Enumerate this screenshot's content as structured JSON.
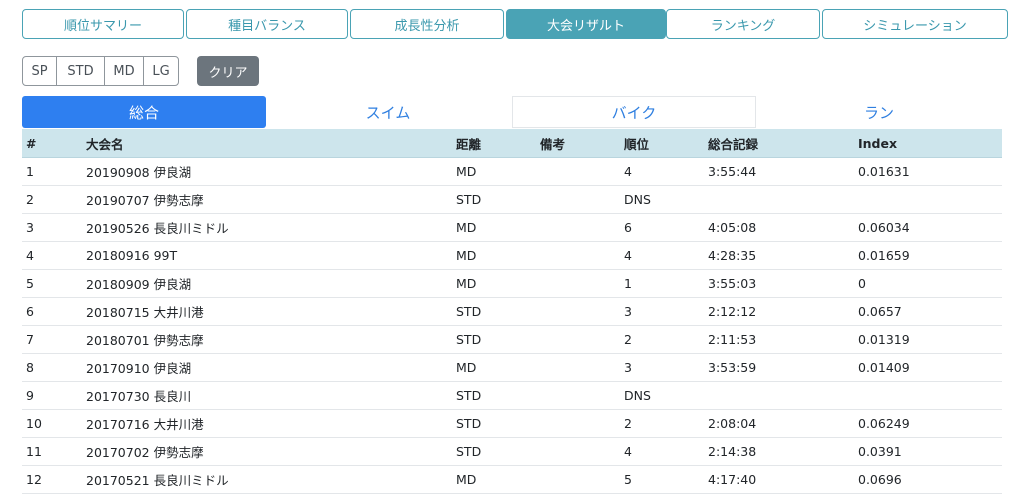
{
  "topnav": {
    "tabs": [
      {
        "label": "順位サマリー"
      },
      {
        "label": "種目バランス"
      },
      {
        "label": "成長性分析"
      },
      {
        "label": "大会リザルト"
      },
      {
        "label": "ランキング"
      },
      {
        "label": "シミュレーション"
      }
    ],
    "active_index": 3
  },
  "size_filter": {
    "options": [
      "SP",
      "STD",
      "MD",
      "LG"
    ],
    "clear_label": "クリア"
  },
  "subtabs": {
    "items": [
      {
        "label": "総合"
      },
      {
        "label": "スイム"
      },
      {
        "label": "バイク"
      },
      {
        "label": "ラン"
      }
    ],
    "active_index": 0
  },
  "table": {
    "headers": [
      "#",
      "大会名",
      "距離",
      "備考",
      "順位",
      "総合記録",
      "Index"
    ],
    "rows": [
      [
        "1",
        "20190908 伊良湖",
        "MD",
        "",
        "4",
        "3:55:44",
        "0.01631"
      ],
      [
        "2",
        "20190707 伊勢志摩",
        "STD",
        "",
        "DNS",
        "",
        ""
      ],
      [
        "3",
        "20190526 長良川ミドル",
        "MD",
        "",
        "6",
        "4:05:08",
        "0.06034"
      ],
      [
        "4",
        "20180916 99T",
        "MD",
        "",
        "4",
        "4:28:35",
        "0.01659"
      ],
      [
        "5",
        "20180909 伊良湖",
        "MD",
        "",
        "1",
        "3:55:03",
        "0"
      ],
      [
        "6",
        "20180715 大井川港",
        "STD",
        "",
        "3",
        "2:12:12",
        "0.0657"
      ],
      [
        "7",
        "20180701 伊勢志摩",
        "STD",
        "",
        "2",
        "2:11:53",
        "0.01319"
      ],
      [
        "8",
        "20170910 伊良湖",
        "MD",
        "",
        "3",
        "3:53:59",
        "0.01409"
      ],
      [
        "9",
        "20170730 長良川",
        "STD",
        "",
        "DNS",
        "",
        ""
      ],
      [
        "10",
        "20170716 大井川港",
        "STD",
        "",
        "2",
        "2:08:04",
        "0.06249"
      ],
      [
        "11",
        "20170702 伊勢志摩",
        "STD",
        "",
        "4",
        "2:14:38",
        "0.0391"
      ],
      [
        "12",
        "20170521 長良川ミドル",
        "MD",
        "",
        "5",
        "4:17:40",
        "0.0696"
      ]
    ]
  },
  "colors": {
    "nav_accent": "#4aa3b5",
    "subtab_active": "#2e7ff0",
    "table_header_bg": "#cde5ec",
    "clear_button": "#6c757d"
  }
}
